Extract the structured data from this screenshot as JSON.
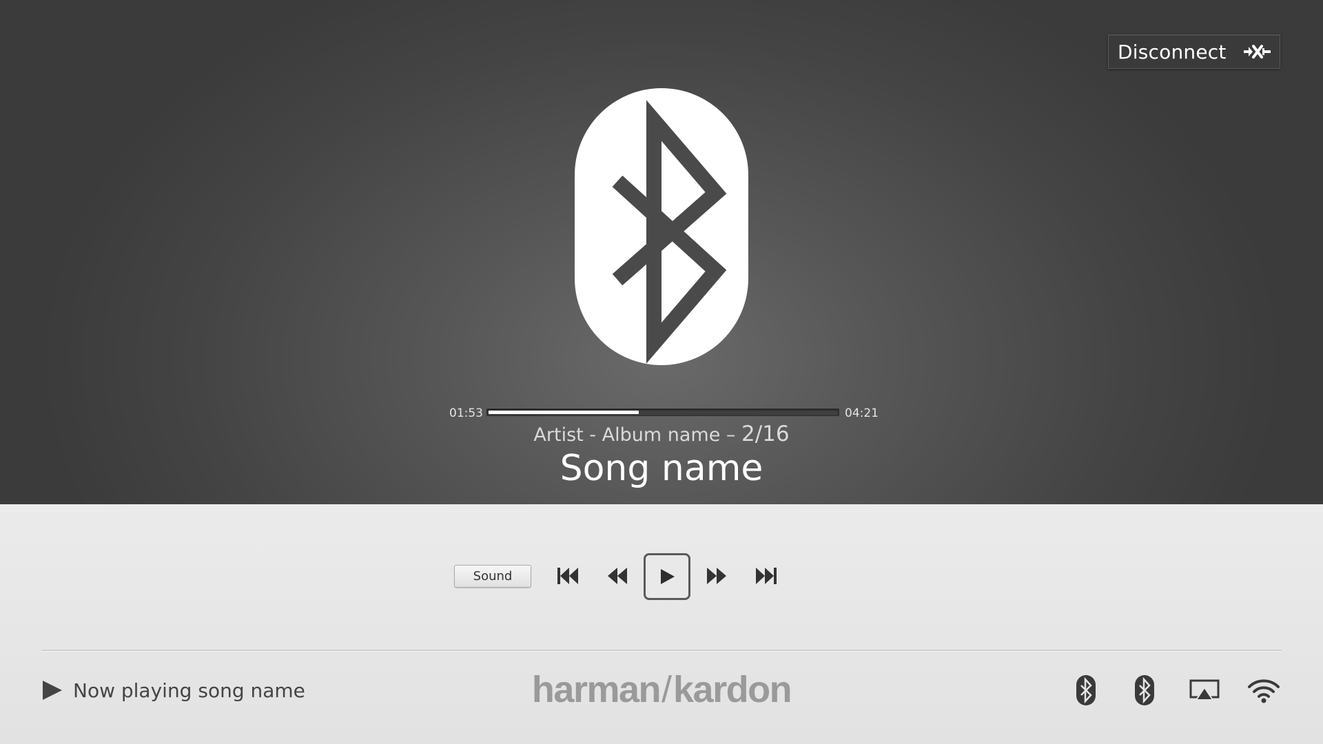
{
  "header": {
    "disconnect_label": "Disconnect",
    "disconnect_icon": "disconnect-plug-icon"
  },
  "source": {
    "icon": "bluetooth-icon"
  },
  "player": {
    "elapsed": "01:53",
    "total": "04:21",
    "progress_fraction": 0.43,
    "meta_text": "Artist - Album name – ",
    "track_position": "2/16",
    "song_name": "Song name"
  },
  "controls": {
    "sound_label": "Sound",
    "buttons": [
      "skip-back-icon",
      "rewind-icon",
      "play-icon",
      "fast-forward-icon",
      "skip-forward-icon"
    ]
  },
  "footer": {
    "now_playing_icon": "play-icon",
    "now_playing": "Now playing song name",
    "brand_left": "harman",
    "brand_slash": "/",
    "brand_right": "kardon",
    "status_icons": [
      "bluetooth-icon",
      "bluetooth-icon",
      "airplay-icon",
      "wifi-icon"
    ]
  },
  "colors": {
    "top_bg": "#4a4a4a",
    "bottom_bg": "#e6e6e6",
    "accent": "#ffffff",
    "icon_dark": "#3a3a3a"
  }
}
